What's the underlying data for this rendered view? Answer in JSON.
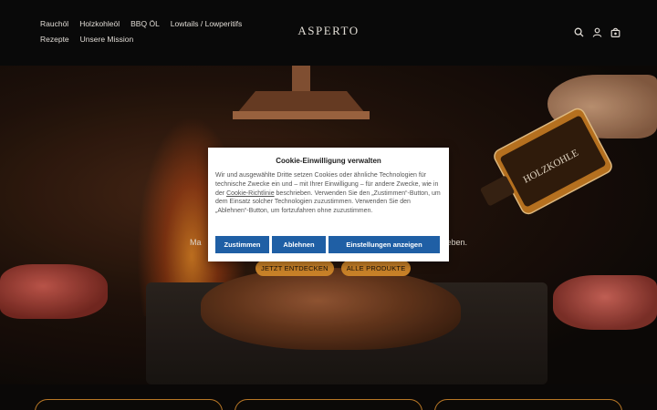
{
  "header": {
    "nav": [
      "Rauchöl",
      "Holzkohleöl",
      "BBQ ÖL",
      "Lowtails / Lowperitifs",
      "Rezepte",
      "Unsere Mission"
    ],
    "logo": "ASPERTO",
    "icons": [
      "search-icon",
      "account-icon",
      "cart-icon"
    ]
  },
  "hero": {
    "text_left": "Ma",
    "text_right": "eben.",
    "cta_primary": "JETZT ENTDECKEN",
    "cta_secondary": "ALLE PRODUKTE",
    "bottle_label": "HOLZKOHLE"
  },
  "cookie": {
    "title": "Cookie-Einwilligung verwalten",
    "text_1": "Wir und ausgewählte Dritte setzen Cookies oder ähnliche Technologien für technische Zwecke ein und – mit Ihrer Einwilligung – für andere Zwecke, wie in der ",
    "link": "Cookie-Richtlinie",
    "text_2": " beschrieben. Verwenden Sie den „Zustimmen“-Button, um dem Einsatz solcher Technologien zuzustimmen. Verwenden Sie den „Ablehnen“-Button, um fortzufahren ohne zuzustimmen.",
    "accept": "Zustimmen",
    "deny": "Ablehnen",
    "settings": "Einstellungen anzeigen"
  },
  "colors": {
    "accent": "#d98d2c",
    "cookie_button": "#1f5fa5",
    "header_bg": "#0a0a0a"
  }
}
